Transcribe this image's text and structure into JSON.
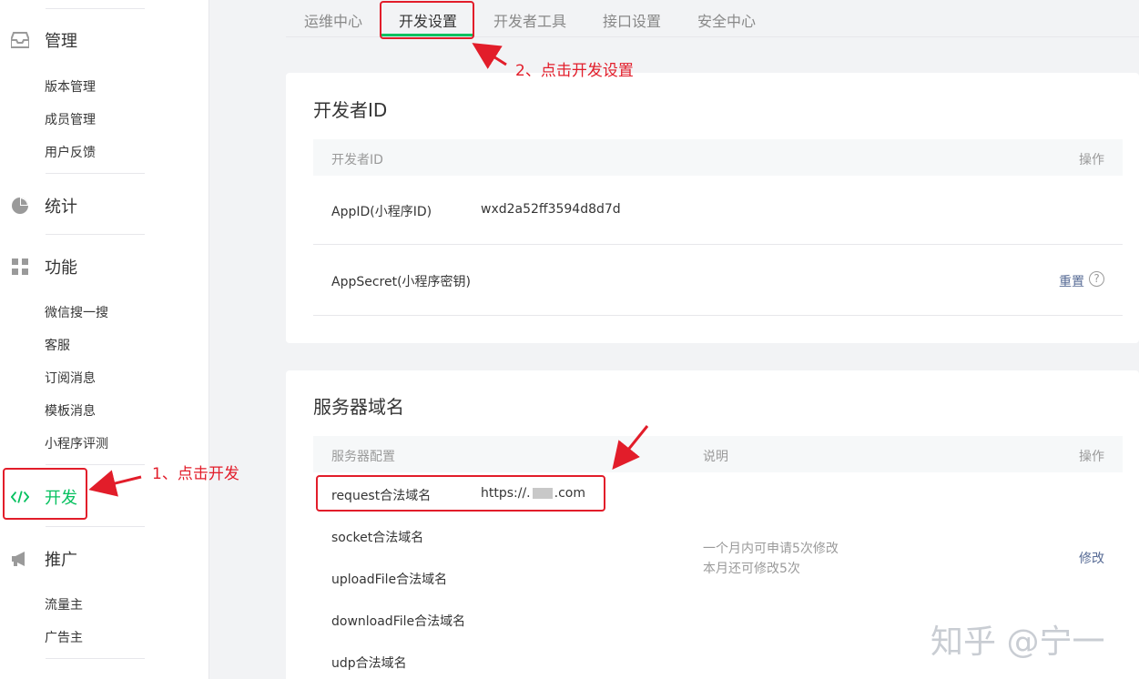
{
  "sidebar": {
    "sections": {
      "manage": {
        "label": "管理",
        "icon": "inbox-icon",
        "items": [
          "版本管理",
          "成员管理",
          "用户反馈"
        ]
      },
      "stats": {
        "label": "统计",
        "icon": "pie-chart-icon"
      },
      "features": {
        "label": "功能",
        "icon": "grid-icon",
        "items": [
          "微信搜一搜",
          "客服",
          "订阅消息",
          "模板消息",
          "小程序评测"
        ]
      },
      "develop": {
        "label": "开发",
        "icon": "code-icon"
      },
      "promote": {
        "label": "推广",
        "icon": "megaphone-icon",
        "items": [
          "流量主",
          "广告主"
        ]
      }
    }
  },
  "tabs": [
    "运维中心",
    "开发设置",
    "开发者工具",
    "接口设置",
    "安全中心"
  ],
  "developer_id": {
    "title": "开发者ID",
    "headers": {
      "name": "开发者ID",
      "action": "操作"
    },
    "rows": [
      {
        "name": "AppID(小程序ID)",
        "value": "wxd2a52ff3594d8d7d"
      },
      {
        "name": "AppSecret(小程序密钥)",
        "action": "重置",
        "help": "?"
      }
    ]
  },
  "server_domain": {
    "title": "服务器域名",
    "headers": {
      "config": "服务器配置",
      "desc": "说明",
      "action": "操作"
    },
    "rows": [
      {
        "name": "request合法域名",
        "value_prefix": "https://.",
        "value_suffix": ".com"
      },
      {
        "name": "socket合法域名"
      },
      {
        "name": "uploadFile合法域名"
      },
      {
        "name": "downloadFile合法域名"
      },
      {
        "name": "udp合法域名"
      }
    ],
    "desc_lines": [
      "一个月内可申请5次修改",
      "本月还可修改5次"
    ],
    "action": "修改"
  },
  "annotations": {
    "step1": "1、点击开发",
    "step2": "2、点击开发设置"
  },
  "watermark": "知乎 @宁一",
  "colors": {
    "accent": "#07c160",
    "annotation": "#e21d2a",
    "link": "#576b95"
  }
}
